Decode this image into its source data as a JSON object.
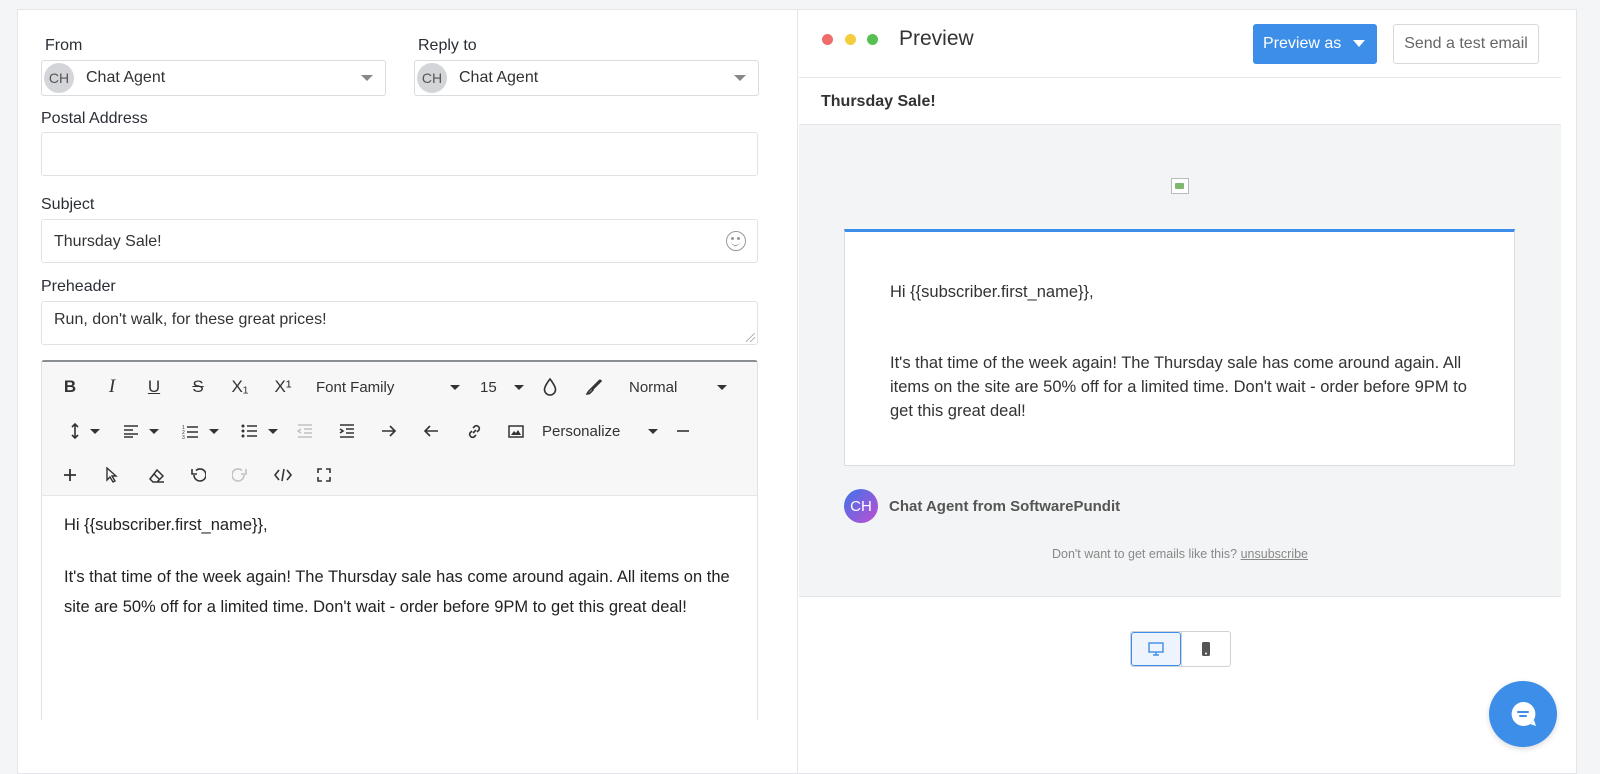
{
  "compose": {
    "from": {
      "label": "From",
      "avatar": "CH",
      "value": "Chat Agent"
    },
    "reply_to": {
      "label": "Reply to",
      "avatar": "CH",
      "value": "Chat Agent"
    },
    "postal_address": {
      "label": "Postal Address",
      "value": ""
    },
    "subject": {
      "label": "Subject",
      "value": "Thursday Sale!"
    },
    "preheader": {
      "label": "Preheader",
      "value": "Run, don't walk, for these great prices!"
    },
    "toolbar": {
      "bold": "B",
      "italic": "I",
      "underline": "U",
      "strike": "S",
      "subscript": "X₁",
      "superscript": "X¹",
      "font_family": "Font Family",
      "font_size": "15",
      "paragraph": "Normal",
      "personalize": "Personalize"
    },
    "body": {
      "greeting": "Hi {{subscriber.first_name}},",
      "paragraph": "It's that time of the week again! The Thursday sale has come around again. All items on the site are 50% off for a limited time. Don't wait - order before 9PM to get this great deal!"
    }
  },
  "preview": {
    "title": "Preview",
    "preview_as": "Preview as",
    "send_test": "Send a test email",
    "subject": "Thursday Sale!",
    "greeting": "Hi {{subscriber.first_name}},",
    "paragraph": "It's that time of the week again! The Thursday sale has come around again. All items on the site are 50% off for a limited time. Don't wait - order before 9PM to get this great deal!",
    "sender_avatar": "CH",
    "sender": "Chat Agent from SoftwarePundit",
    "unsubscribe_text": "Don't want to get emails like this?",
    "unsubscribe_link": "unsubscribe"
  },
  "colors": {
    "accent": "#3d8ee8",
    "dot_red": "#f06b6b",
    "dot_yellow": "#f4cc3c",
    "dot_green": "#56c152"
  }
}
